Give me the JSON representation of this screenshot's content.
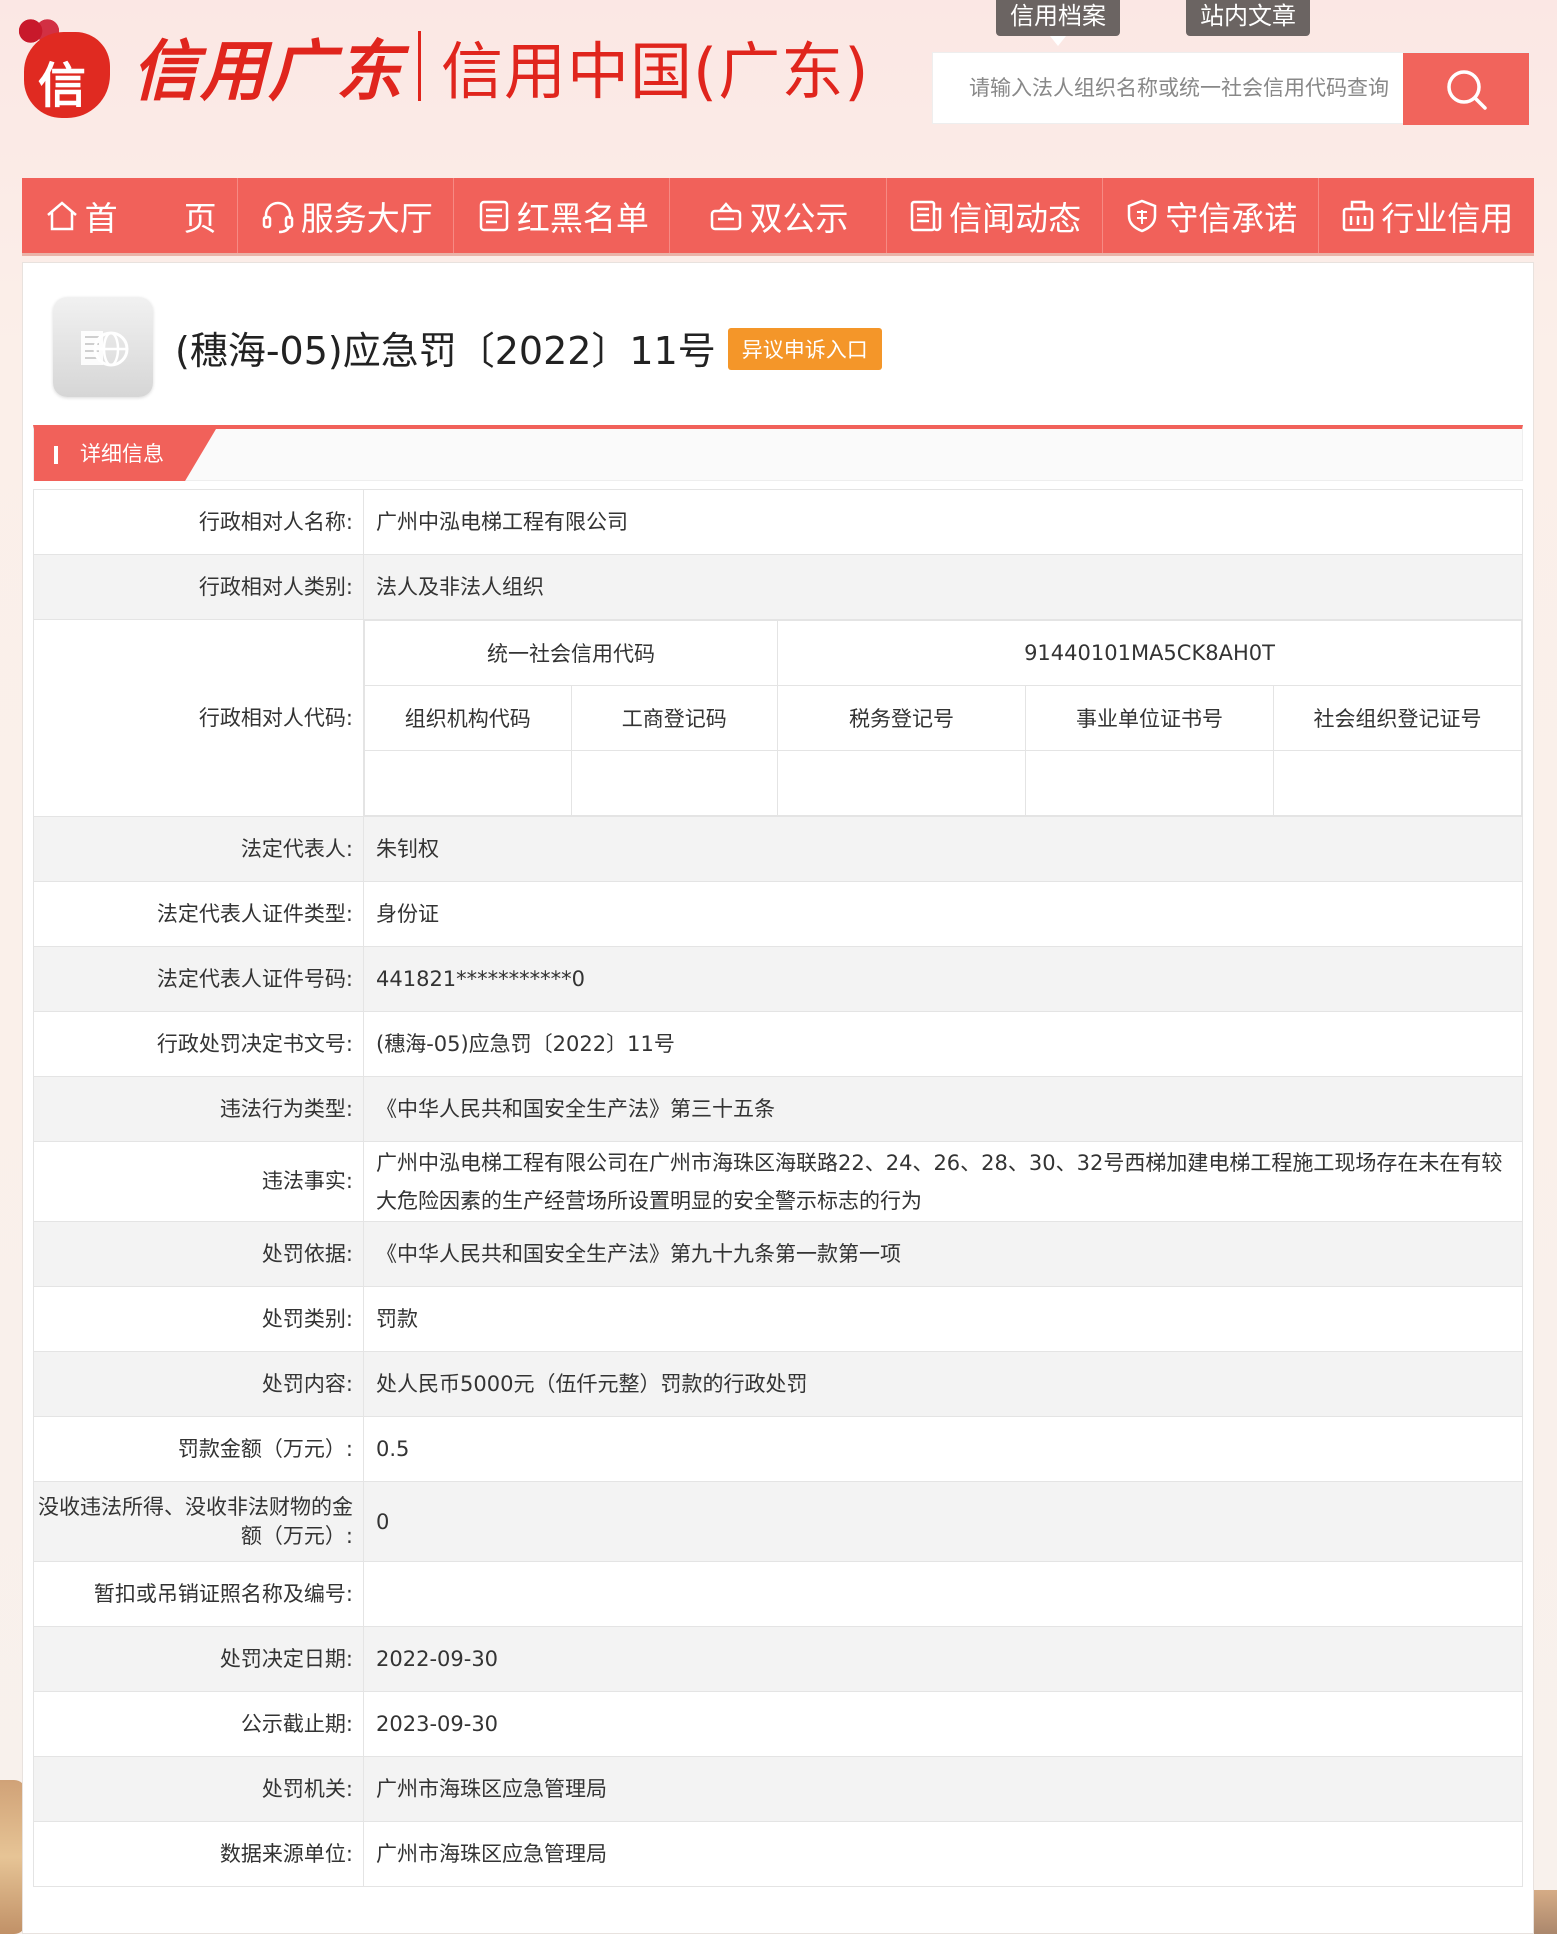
{
  "header": {
    "logo_script": "信用广东",
    "logo_text": "信用中国(广东)",
    "tabs": [
      "信用档案",
      "站内文章"
    ],
    "search_placeholder": "请输入法人组织名称或统一社会信用代码查询"
  },
  "nav": {
    "items": [
      "首　　页",
      "服务大厅",
      "红黑名单",
      "双公示",
      "信闻动态",
      "守信承诺",
      "行业信用"
    ]
  },
  "record": {
    "title": "(穗海-05)应急罚〔2022〕11号",
    "appeal_label": "异议申诉入口",
    "section_label": "详细信息"
  },
  "fields": {
    "name": {
      "label": "行政相对人名称:",
      "value": "广州中泓电梯工程有限公司"
    },
    "category": {
      "label": "行政相对人类别:",
      "value": "法人及非法人组织"
    },
    "code": {
      "label": "行政相对人代码:",
      "uscc_label": "统一社会信用代码",
      "uscc_value": "91440101MA5CK8AH0T",
      "sub_headers": [
        "组织机构代码",
        "工商登记码",
        "税务登记号",
        "事业单位证书号",
        "社会组织登记证号"
      ]
    },
    "legal_rep": {
      "label": "法定代表人:",
      "value": "朱钊权"
    },
    "id_type": {
      "label": "法定代表人证件类型:",
      "value": "身份证"
    },
    "id_number": {
      "label": "法定代表人证件号码:",
      "value": "441821***********0"
    },
    "decision_no": {
      "label": "行政处罚决定书文号:",
      "value": "(穗海-05)应急罚〔2022〕11号"
    },
    "violation_type": {
      "label": "违法行为类型:",
      "value": "《中华人民共和国安全生产法》第三十五条"
    },
    "violation_fact": {
      "label": "违法事实:",
      "value": "广州中泓电梯工程有限公司在广州市海珠区海联路22、24、26、28、30、32号西梯加建电梯工程施工现场存在未在有较大危险因素的生产经营场所设置明显的安全警示标志的行为"
    },
    "basis": {
      "label": "处罚依据:",
      "value": "《中华人民共和国安全生产法》第九十九条第一款第一项"
    },
    "penalty_type": {
      "label": "处罚类别:",
      "value": "罚款"
    },
    "penalty_content": {
      "label": "处罚内容:",
      "value": "处人民币5000元（伍仟元整）罚款的行政处罚"
    },
    "fine_amount": {
      "label": "罚款金额（万元）:",
      "value": "0.5"
    },
    "confiscation": {
      "label": "没收违法所得、没收非法财物的金额（万元）:",
      "value": "0"
    },
    "license": {
      "label": "暂扣或吊销证照名称及编号:",
      "value": ""
    },
    "decision_date": {
      "label": "处罚决定日期:",
      "value": "2022-09-30"
    },
    "publish_deadline": {
      "label": "公示截止期:",
      "value": "2023-09-30"
    },
    "authority": {
      "label": "处罚机关:",
      "value": "广州市海珠区应急管理局"
    },
    "data_source": {
      "label": "数据来源单位:",
      "value": "广州市海珠区应急管理局"
    }
  },
  "colors": {
    "brand_red": "#f1615a",
    "logo_red": "#e0251d",
    "appeal_orange": "#f49629"
  }
}
